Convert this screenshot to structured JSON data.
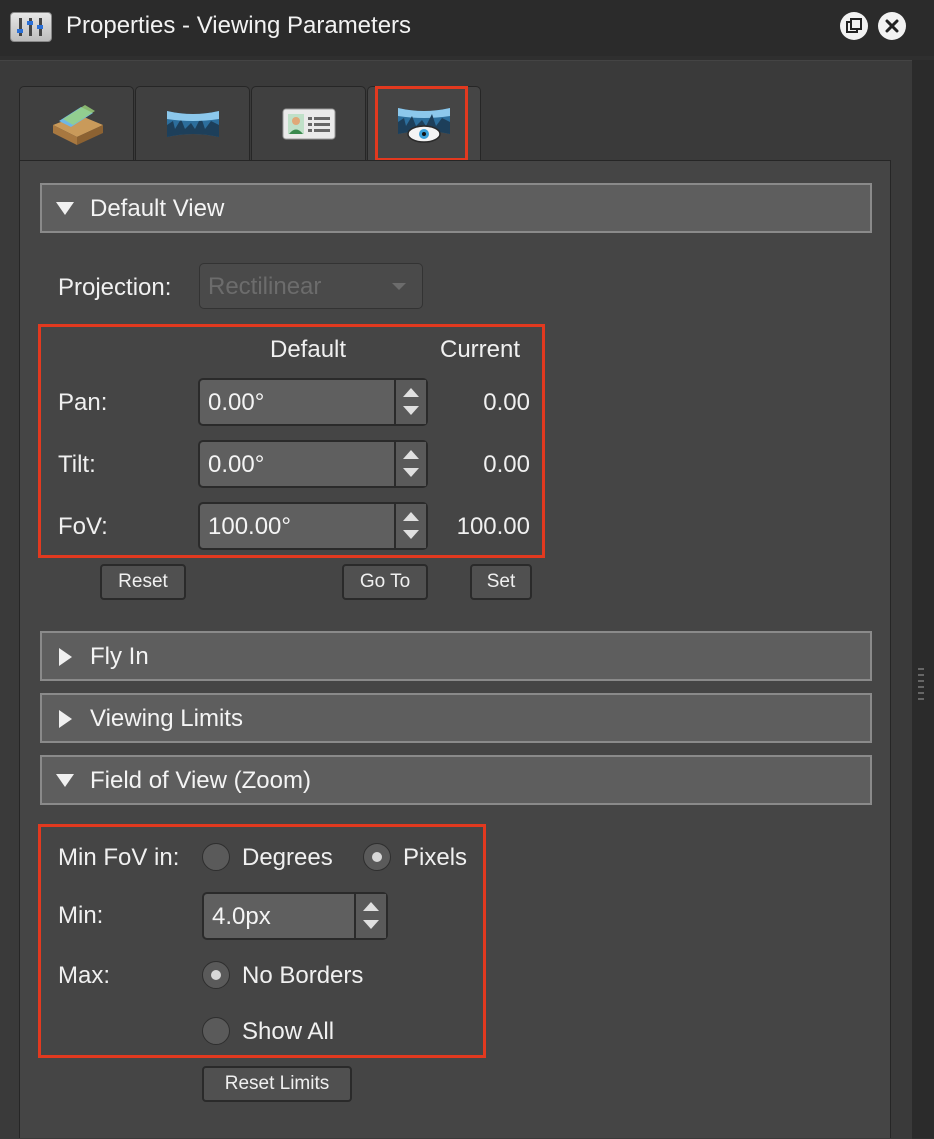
{
  "window": {
    "title": "Properties - Viewing Parameters"
  },
  "tabs": [
    {
      "icon": "layers-tray-icon"
    },
    {
      "icon": "panorama-icon"
    },
    {
      "icon": "id-card-icon"
    },
    {
      "icon": "panorama-eye-icon",
      "active": true
    }
  ],
  "default_view": {
    "header": "Default View",
    "projection_label": "Projection:",
    "projection_value": "Rectilinear",
    "col_default": "Default",
    "col_current": "Current",
    "rows": [
      {
        "label": "Pan:",
        "default": "0.00°",
        "current": "0.00"
      },
      {
        "label": "Tilt:",
        "default": "0.00°",
        "current": "0.00"
      },
      {
        "label": "FoV:",
        "default": "100.00°",
        "current": "100.00"
      }
    ],
    "reset_label": "Reset",
    "goto_label": "Go To",
    "set_label": "Set"
  },
  "fly_in": {
    "header": "Fly In"
  },
  "viewing_limits": {
    "header": "Viewing Limits"
  },
  "fov_zoom": {
    "header": "Field of View (Zoom)",
    "min_fov_in_label": "Min FoV in:",
    "degrees_label": "Degrees",
    "pixels_label": "Pixels",
    "min_label": "Min:",
    "min_value": "4.0px",
    "max_label": "Max:",
    "no_borders_label": "No Borders",
    "show_all_label": "Show All",
    "reset_limits_label": "Reset Limits"
  },
  "colors": {
    "highlight": "#e2391f",
    "panel": "#454545",
    "header": "#5e5e5e"
  }
}
